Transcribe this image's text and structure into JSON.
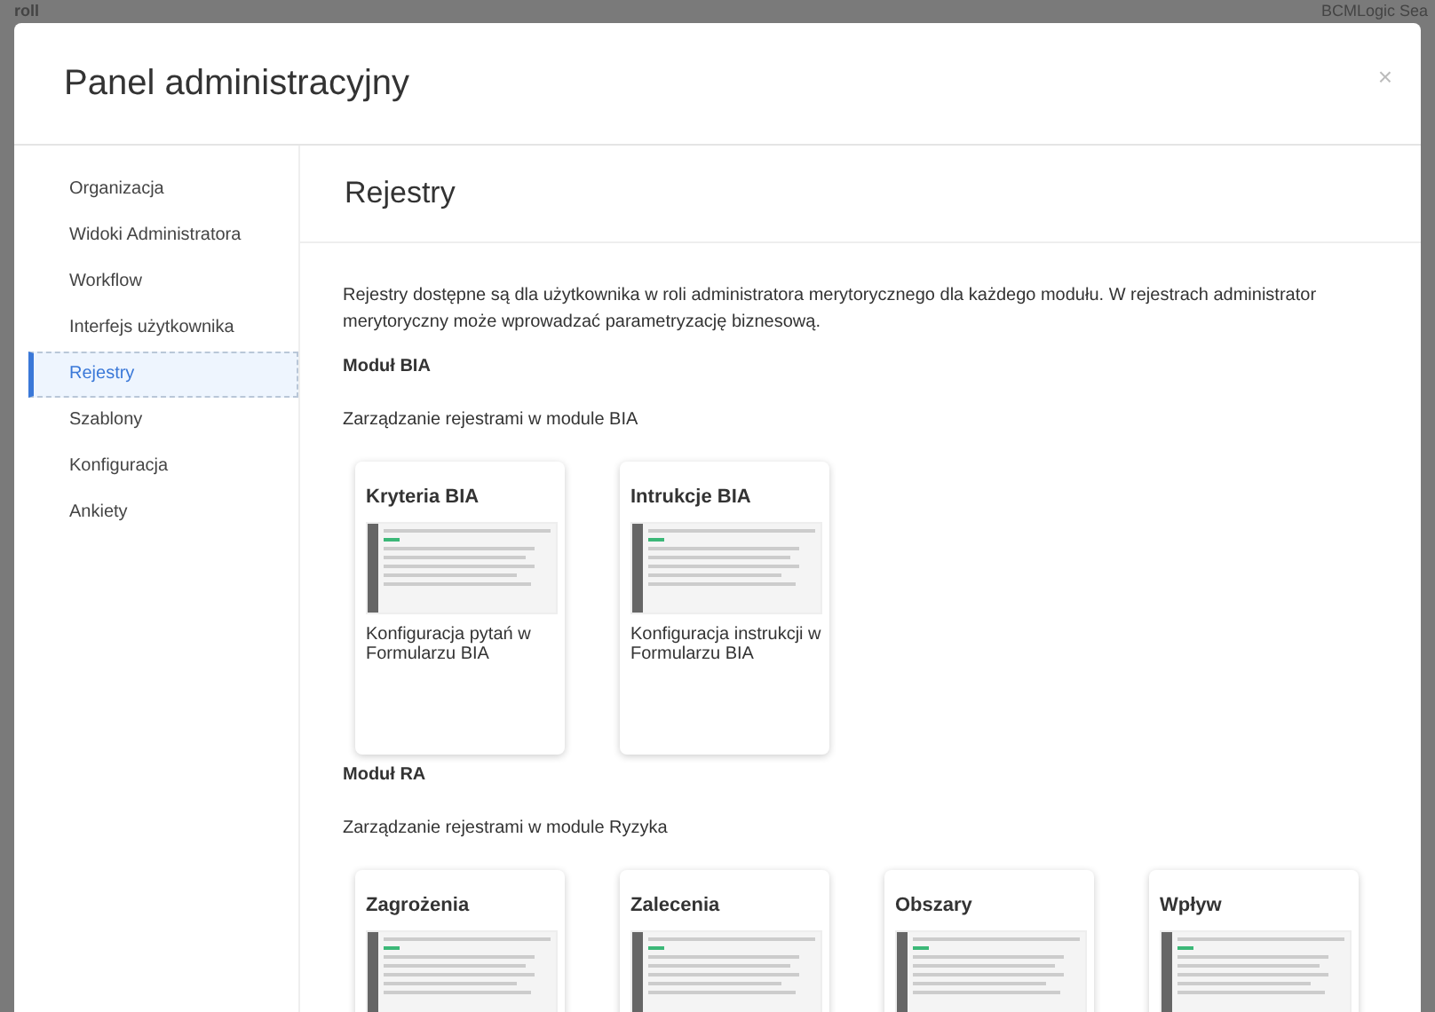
{
  "background_bar": {
    "left_text": "roll",
    "right_text": "BCMLogic Sea"
  },
  "modal": {
    "title": "Panel administracyjny",
    "close": "×"
  },
  "sidebar": {
    "items": [
      {
        "label": "Organizacja",
        "selected": false
      },
      {
        "label": "Widoki Administratora",
        "selected": false
      },
      {
        "label": "Workflow",
        "selected": false
      },
      {
        "label": "Interfejs użytkownika",
        "selected": false
      },
      {
        "label": "Rejestry",
        "selected": true
      },
      {
        "label": "Szablony",
        "selected": false
      },
      {
        "label": "Konfiguracja",
        "selected": false
      },
      {
        "label": "Ankiety",
        "selected": false
      }
    ]
  },
  "content": {
    "heading": "Rejestry",
    "intro": "Rejestry dostępne są dla użytkownika w roli administratora merytorycznego dla każdego modułu. W rejestrach administrator merytoryczny może wprowadzać parametryzację biznesową.",
    "sections": [
      {
        "title": "Moduł BIA",
        "subtitle": "Zarządzanie rejestrami w module BIA",
        "cards": [
          {
            "title": "Kryteria BIA",
            "description": "Konfiguracja pytań w Formularzu BIA"
          },
          {
            "title": "Intrukcje BIA",
            "description": "Konfiguracja instrukcji w Formularzu BIA"
          }
        ]
      },
      {
        "title": "Moduł RA",
        "subtitle": "Zarządzanie rejestrami w module Ryzyka",
        "cards": [
          {
            "title": "Zagrożenia"
          },
          {
            "title": "Zalecenia"
          },
          {
            "title": "Obszary"
          },
          {
            "title": "Wpływ"
          }
        ]
      }
    ]
  }
}
